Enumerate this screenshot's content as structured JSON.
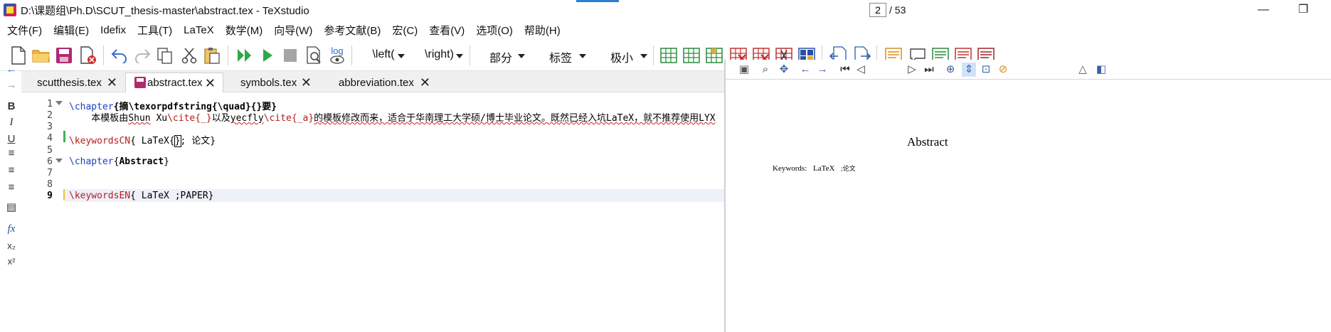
{
  "window": {
    "title": "D:\\课题组\\Ph.D\\SCUT_thesis-master\\abstract.tex - TeXstudio",
    "minimize": "—",
    "restore": "❐"
  },
  "menu": [
    "文件(F)",
    "编辑(E)",
    "Idefix",
    "工具(T)",
    "LaTeX",
    "数学(M)",
    "向导(W)",
    "参考文献(B)",
    "宏(C)",
    "查看(V)",
    "选项(O)",
    "帮助(H)"
  ],
  "toolbar": {
    "left_combo": "\\left(",
    "right_combo": "\\right)",
    "section_combo": "部分",
    "label_combo": "标签",
    "size_combo": "极小",
    "log_label": "log"
  },
  "tabs": [
    {
      "label": "scutthesis.tex"
    },
    {
      "label": "abstract.tex"
    },
    {
      "label": "symbols.tex"
    },
    {
      "label": "abbreviation.tex"
    }
  ],
  "editor": {
    "line_numbers": [
      "1",
      "2",
      "3",
      "4",
      "5",
      "6",
      "7",
      "8",
      "9"
    ],
    "line1": {
      "cmd": "\\chapter",
      "arg_open": "{摘",
      "inner": "\\texorpdfstring{\\quad}{}",
      "arg_close": "要}"
    },
    "line2": {
      "p1": "    本模板由",
      "p2": "Shun",
      "p3": " Xu",
      "p4": "\\cite",
      "p5": "{_}",
      "p6": "以及",
      "p7": "yecfly",
      "p8": "\\cite",
      "p9": "{_a}",
      "p10": "的模板修改而来，适合于华南理工大学硕/博士毕业论文。既然已经入坑LaTeX，就不推荐使用LYX"
    },
    "line4": {
      "cmd": "\\keywordsCN",
      "rest": "{ LaTeX{",
      "cursor": "}",
      "tail": "; 论文}"
    },
    "line6": {
      "cmd": "\\chapter",
      "arg_open": "{",
      "arg": "Abstract",
      "arg_close": "}"
    },
    "line9": {
      "cmd": "\\keywordsEN",
      "rest": "{ LaTeX ;PAPER}"
    }
  },
  "pdf": {
    "current_page": "2",
    "total_pages": "/ 53",
    "heading": "Abstract",
    "keywords_label": "Keywords:",
    "keywords_value": "LaTeX",
    "keywords_garbled": ";论文"
  },
  "side_labels": {
    "bold": "B",
    "italic": "I",
    "underline": "U",
    "fx": "fx",
    "sub": "x₂",
    "sup": "x²"
  }
}
